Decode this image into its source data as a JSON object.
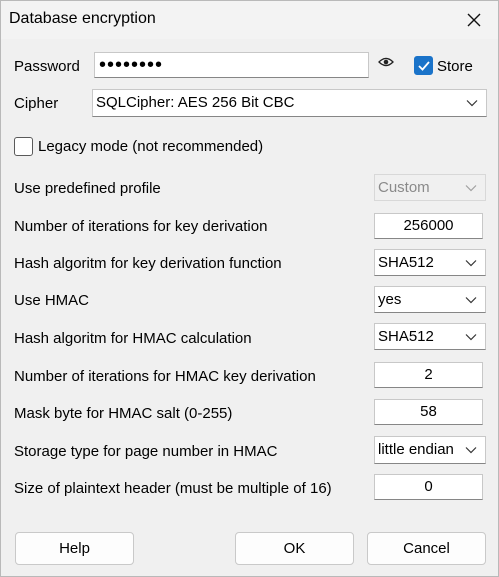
{
  "window": {
    "title": "Database encryption"
  },
  "password": {
    "label": "Password",
    "value": "••••••••",
    "store_label": "Store",
    "store_checked": true
  },
  "cipher": {
    "label": "Cipher",
    "value": "SQLCipher: AES 256 Bit CBC"
  },
  "legacy": {
    "label": "Legacy mode (not recommended)",
    "checked": false
  },
  "settings": {
    "profile_label": "Use predefined profile",
    "profile_value": "Custom",
    "kdf_iter_label": "Number of iterations for key derivation",
    "kdf_iter_value": "256000",
    "kdf_hash_label": "Hash algoritm for key derivation function",
    "kdf_hash_value": "SHA512",
    "hmac_label": "Use HMAC",
    "hmac_value": "yes",
    "hmac_hash_label": "Hash algoritm for HMAC calculation",
    "hmac_hash_value": "SHA512",
    "hmac_iter_label": "Number of iterations for HMAC key derivation",
    "hmac_iter_value": "2",
    "mask_label": "Mask byte for HMAC salt (0-255)",
    "mask_value": "58",
    "storage_label": "Storage type for page number in HMAC",
    "storage_value": "little endian",
    "header_label": "Size of plaintext header (must be multiple of 16)",
    "header_value": "0"
  },
  "buttons": {
    "help": "Help",
    "ok": "OK",
    "cancel": "Cancel"
  },
  "colors": {
    "accent": "#1a73c9",
    "background": "#f0f0f0"
  }
}
